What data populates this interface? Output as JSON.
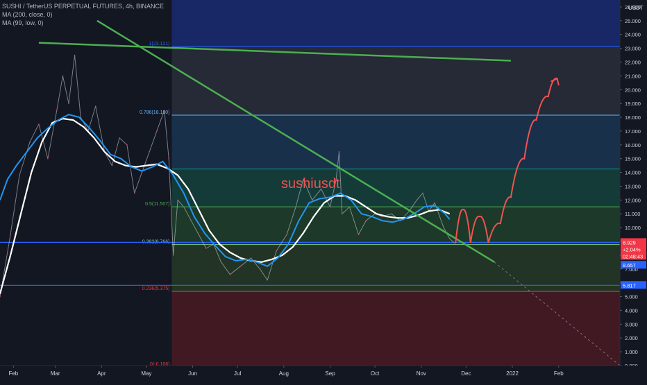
{
  "legend": {
    "title": "SUSHI / TetherUS PERPETUAL FUTURES, 4h, BINANCE",
    "ma200": "MA (200, close, 0)",
    "ma99": "MA (99, low, 0)"
  },
  "colors": {
    "background": "#131722",
    "price_line": "#d1d4dc",
    "ma200": "#ffffff",
    "ma99": "#2196f3",
    "trendline": "#4caf50",
    "projection": "#ef5350",
    "fib_support": "#2962ff"
  },
  "annotation": {
    "text": "sushiusdt",
    "color": "#ef5350"
  },
  "chart_data": {
    "type": "line",
    "title": "SUSHI / TetherUS PERPETUAL FUTURES, 4h, BINANCE",
    "yunit": "USDT",
    "ylim": [
      0,
      26.5
    ],
    "yticks": [
      "0.000",
      "1.000",
      "2.000",
      "3.000",
      "4.000",
      "5.000",
      "6.000",
      "7.000",
      "8.000",
      "9.000",
      "10.000",
      "11.000",
      "12.000",
      "13.000",
      "14.000",
      "15.000",
      "16.000",
      "17.000",
      "18.000",
      "19.000",
      "20.000",
      "21.000",
      "22.000",
      "23.000",
      "24.000",
      "25.000",
      "26.000"
    ],
    "xlim": [
      "2021-01-23",
      "2022-03-14"
    ],
    "xticks": [
      {
        "date": "2021-02-01",
        "label": "Feb"
      },
      {
        "date": "2021-03-01",
        "label": "Mar"
      },
      {
        "date": "2021-04-01",
        "label": "Apr"
      },
      {
        "date": "2021-05-01",
        "label": "May"
      },
      {
        "date": "2021-06-01",
        "label": "Jun"
      },
      {
        "date": "2021-07-01",
        "label": "Jul"
      },
      {
        "date": "2021-08-01",
        "label": "Aug"
      },
      {
        "date": "2021-09-01",
        "label": "Sep"
      },
      {
        "date": "2021-10-01",
        "label": "Oct"
      },
      {
        "date": "2021-11-01",
        "label": "Nov"
      },
      {
        "date": "2021-12-01",
        "label": "Dec"
      },
      {
        "date": "2022-01-01",
        "label": "2022"
      },
      {
        "date": "2022-02-01",
        "label": "Feb"
      }
    ],
    "series": [
      {
        "name": "SUSHI / TetherUS PERPETUAL FUTURES",
        "style": "price",
        "points": [
          [
            "2021-01-23",
            5.0
          ],
          [
            "2021-01-30",
            9.5
          ],
          [
            "2021-02-05",
            13.8
          ],
          [
            "2021-02-12",
            16.2
          ],
          [
            "2021-02-18",
            17.5
          ],
          [
            "2021-02-24",
            15.0
          ],
          [
            "2021-03-02",
            18.5
          ],
          [
            "2021-03-06",
            21.0
          ],
          [
            "2021-03-10",
            19.0
          ],
          [
            "2021-03-14",
            22.5
          ],
          [
            "2021-03-18",
            18.0
          ],
          [
            "2021-03-23",
            17.0
          ],
          [
            "2021-03-28",
            18.8
          ],
          [
            "2021-04-03",
            15.5
          ],
          [
            "2021-04-08",
            14.5
          ],
          [
            "2021-04-13",
            16.5
          ],
          [
            "2021-04-18",
            16.0
          ],
          [
            "2021-04-23",
            12.5
          ],
          [
            "2021-04-28",
            14.0
          ],
          [
            "2021-05-03",
            15.5
          ],
          [
            "2021-05-08",
            17.0
          ],
          [
            "2021-05-13",
            18.5
          ],
          [
            "2021-05-16",
            15.0
          ],
          [
            "2021-05-19",
            8.0
          ],
          [
            "2021-05-22",
            12.0
          ],
          [
            "2021-05-26",
            11.5
          ],
          [
            "2021-05-31",
            10.5
          ],
          [
            "2021-06-05",
            9.5
          ],
          [
            "2021-06-10",
            8.5
          ],
          [
            "2021-06-15",
            8.8
          ],
          [
            "2021-06-20",
            7.5
          ],
          [
            "2021-06-26",
            6.6
          ],
          [
            "2021-07-03",
            7.2
          ],
          [
            "2021-07-10",
            7.8
          ],
          [
            "2021-07-16",
            7.0
          ],
          [
            "2021-07-21",
            6.2
          ],
          [
            "2021-07-27",
            8.3
          ],
          [
            "2021-08-03",
            9.5
          ],
          [
            "2021-08-09",
            11.5
          ],
          [
            "2021-08-14",
            13.5
          ],
          [
            "2021-08-20",
            12.0
          ],
          [
            "2021-08-26",
            12.8
          ],
          [
            "2021-09-01",
            11.5
          ],
          [
            "2021-09-05",
            13.5
          ],
          [
            "2021-09-07",
            15.5
          ],
          [
            "2021-09-09",
            11.0
          ],
          [
            "2021-09-14",
            11.5
          ],
          [
            "2021-09-20",
            9.5
          ],
          [
            "2021-09-25",
            10.5
          ],
          [
            "2021-10-01",
            11.0
          ],
          [
            "2021-10-06",
            10.8
          ],
          [
            "2021-10-12",
            11.0
          ],
          [
            "2021-10-18",
            10.5
          ],
          [
            "2021-10-24",
            11.2
          ],
          [
            "2021-10-29",
            12.0
          ],
          [
            "2021-11-02",
            12.5
          ],
          [
            "2021-11-06",
            11.2
          ],
          [
            "2021-11-10",
            11.8
          ],
          [
            "2021-11-16",
            10.0
          ],
          [
            "2021-11-20",
            9.2
          ],
          [
            "2021-11-23",
            8.9
          ]
        ]
      },
      {
        "name": "MA (200, close, 0)",
        "style": "ma200",
        "points": [
          [
            "2021-01-23",
            5.2
          ],
          [
            "2021-01-30",
            8.0
          ],
          [
            "2021-02-06",
            11.0
          ],
          [
            "2021-02-13",
            14.0
          ],
          [
            "2021-02-20",
            16.2
          ],
          [
            "2021-02-27",
            17.6
          ],
          [
            "2021-03-06",
            17.9
          ],
          [
            "2021-03-13",
            17.8
          ],
          [
            "2021-03-20",
            17.3
          ],
          [
            "2021-03-27",
            16.5
          ],
          [
            "2021-04-03",
            15.5
          ],
          [
            "2021-04-10",
            14.8
          ],
          [
            "2021-04-17",
            14.5
          ],
          [
            "2021-04-24",
            14.4
          ],
          [
            "2021-05-01",
            14.5
          ],
          [
            "2021-05-08",
            14.6
          ],
          [
            "2021-05-15",
            14.3
          ],
          [
            "2021-05-22",
            13.8
          ],
          [
            "2021-05-29",
            12.8
          ],
          [
            "2021-06-05",
            11.3
          ],
          [
            "2021-06-12",
            9.8
          ],
          [
            "2021-06-19",
            8.8
          ],
          [
            "2021-06-26",
            8.2
          ],
          [
            "2021-07-03",
            7.8
          ],
          [
            "2021-07-10",
            7.6
          ],
          [
            "2021-07-17",
            7.5
          ],
          [
            "2021-07-24",
            7.7
          ],
          [
            "2021-07-31",
            8.0
          ],
          [
            "2021-08-07",
            8.6
          ],
          [
            "2021-08-14",
            9.6
          ],
          [
            "2021-08-21",
            10.8
          ],
          [
            "2021-08-28",
            11.8
          ],
          [
            "2021-09-04",
            12.3
          ],
          [
            "2021-09-11",
            12.3
          ],
          [
            "2021-09-18",
            12.0
          ],
          [
            "2021-09-25",
            11.5
          ],
          [
            "2021-10-02",
            11.0
          ],
          [
            "2021-10-09",
            10.8
          ],
          [
            "2021-10-16",
            10.7
          ],
          [
            "2021-10-23",
            10.7
          ],
          [
            "2021-10-30",
            10.9
          ],
          [
            "2021-11-06",
            11.2
          ],
          [
            "2021-11-13",
            11.3
          ],
          [
            "2021-11-20",
            11.0
          ]
        ]
      },
      {
        "name": "MA (99, low, 0)",
        "style": "ma99",
        "points": [
          [
            "2021-01-23",
            12.0
          ],
          [
            "2021-01-28",
            13.5
          ],
          [
            "2021-02-03",
            14.5
          ],
          [
            "2021-02-10",
            15.5
          ],
          [
            "2021-02-17",
            16.5
          ],
          [
            "2021-02-24",
            17.2
          ],
          [
            "2021-03-03",
            17.8
          ],
          [
            "2021-03-10",
            18.2
          ],
          [
            "2021-03-17",
            18.0
          ],
          [
            "2021-03-24",
            17.2
          ],
          [
            "2021-03-31",
            16.3
          ],
          [
            "2021-04-07",
            15.3
          ],
          [
            "2021-04-14",
            15.0
          ],
          [
            "2021-04-21",
            14.4
          ],
          [
            "2021-04-28",
            14.1
          ],
          [
            "2021-05-05",
            14.4
          ],
          [
            "2021-05-12",
            14.8
          ],
          [
            "2021-05-19",
            13.8
          ],
          [
            "2021-05-26",
            12.5
          ],
          [
            "2021-06-02",
            10.8
          ],
          [
            "2021-06-09",
            9.6
          ],
          [
            "2021-06-16",
            8.7
          ],
          [
            "2021-06-23",
            7.9
          ],
          [
            "2021-06-30",
            7.6
          ],
          [
            "2021-07-07",
            7.7
          ],
          [
            "2021-07-14",
            7.5
          ],
          [
            "2021-07-21",
            7.2
          ],
          [
            "2021-07-28",
            7.8
          ],
          [
            "2021-08-04",
            8.8
          ],
          [
            "2021-08-11",
            10.5
          ],
          [
            "2021-08-18",
            11.8
          ],
          [
            "2021-08-25",
            12.1
          ],
          [
            "2021-09-01",
            12.2
          ],
          [
            "2021-09-08",
            12.5
          ],
          [
            "2021-09-15",
            12.0
          ],
          [
            "2021-09-22",
            11.0
          ],
          [
            "2021-09-29",
            10.8
          ],
          [
            "2021-10-06",
            10.5
          ],
          [
            "2021-10-13",
            10.4
          ],
          [
            "2021-10-20",
            10.6
          ],
          [
            "2021-10-27",
            11.0
          ],
          [
            "2021-11-03",
            11.5
          ],
          [
            "2021-11-10",
            11.6
          ],
          [
            "2021-11-17",
            11.0
          ],
          [
            "2021-11-20",
            10.6
          ]
        ]
      }
    ],
    "fib_levels": [
      {
        "ratio": "0",
        "value": -0.106,
        "label": "0(-0.106)",
        "color": "#f23645"
      },
      {
        "ratio": "0.236",
        "value": 5.375,
        "label": "0.236(5.375)",
        "color": "#f23645"
      },
      {
        "ratio": "0.382",
        "value": 8.766,
        "label": "0.382(8.766)",
        "color": "#81c784"
      },
      {
        "ratio": "0.5",
        "value": 11.507,
        "label": "0.5(11.507)",
        "color": "#4caf50"
      },
      {
        "ratio": "0.618",
        "value": 14.248,
        "label": "",
        "color": "#089981"
      },
      {
        "ratio": "0.786",
        "value": 18.15,
        "label": "0.786(18.150)",
        "color": "#64b5f6"
      },
      {
        "ratio": "1",
        "value": 23.121,
        "label": "1(23.121)",
        "color": "#2962ff"
      }
    ],
    "fib_start_date": "2021-05-18",
    "fib_end_date": "2022-03-14",
    "horizontal_lines": [
      {
        "value": 8.93,
        "color": "#2962ff"
      },
      {
        "value": 5.817,
        "color": "#2962ff"
      }
    ],
    "trendlines": [
      {
        "from": [
          "2021-02-18",
          23.4
        ],
        "to": [
          "2021-12-31",
          22.1
        ]
      },
      {
        "from": [
          "2021-03-29",
          25.0
        ],
        "to": [
          "2021-12-20",
          7.5
        ]
      }
    ],
    "trendline_extension": {
      "from": [
        "2021-12-20",
        7.5
      ],
      "to": [
        "2022-03-14",
        0.0
      ]
    },
    "projection_path": [
      [
        "2021-11-24",
        8.9
      ],
      [
        "2021-11-29",
        11.3
      ],
      [
        "2021-12-04",
        8.9
      ],
      [
        "2021-12-10",
        10.8
      ],
      [
        "2021-12-16",
        8.9
      ],
      [
        "2021-12-24",
        10.3
      ],
      [
        "2021-12-31",
        12.2
      ],
      [
        "2022-01-09",
        15.0
      ],
      [
        "2022-01-17",
        17.8
      ],
      [
        "2022-01-25",
        19.5
      ],
      [
        "2022-01-31",
        20.8
      ]
    ],
    "price_labels": [
      {
        "text": "8.929",
        "value": 8.93,
        "color": "#f23645"
      },
      {
        "text": "+2.04%",
        "value": 8.43,
        "color": "#f23645"
      },
      {
        "text": "02:48:43",
        "value": 7.93,
        "color": "#f23645"
      },
      {
        "text": "8.657",
        "value": 7.28,
        "color": "#2962ff"
      },
      {
        "text": "5.817",
        "value": 5.82,
        "color": "#2962ff"
      }
    ]
  }
}
